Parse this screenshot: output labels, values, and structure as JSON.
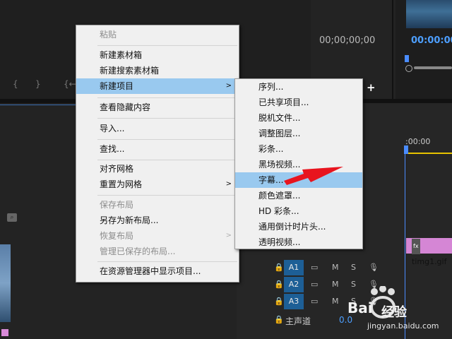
{
  "timecode_left": "00;00;00;00",
  "timecode_right": "00:00:00",
  "time_ruler_label": ":00:00",
  "context_menu": {
    "items": [
      {
        "label": "粘贴",
        "disabled": true
      },
      {
        "label": "新建素材箱"
      },
      {
        "label": "新建搜索素材箱"
      },
      {
        "label": "新建项目",
        "submenu": true,
        "highlighted": true
      },
      {
        "label": "查看隐藏内容"
      },
      {
        "label": "导入..."
      },
      {
        "label": "查找..."
      },
      {
        "label": "对齐网格"
      },
      {
        "label": "重置为网格",
        "submenu": true
      },
      {
        "label": "保存布局",
        "disabled": true
      },
      {
        "label": "另存为新布局..."
      },
      {
        "label": "恢复布局",
        "disabled": true,
        "submenu": true
      },
      {
        "label": "管理已保存的布局...",
        "disabled": true
      },
      {
        "label": "在资源管理器中显示项目..."
      }
    ]
  },
  "submenu": {
    "items": [
      {
        "label": "序列..."
      },
      {
        "label": "已共享项目..."
      },
      {
        "label": "脱机文件..."
      },
      {
        "label": "调整图层..."
      },
      {
        "label": "彩条..."
      },
      {
        "label": "黑场视频..."
      },
      {
        "label": "字幕...",
        "highlighted": true
      },
      {
        "label": "颜色遮罩..."
      },
      {
        "label": "HD 彩条..."
      },
      {
        "label": "通用倒计时片头..."
      },
      {
        "label": "透明视频..."
      }
    ]
  },
  "clip": {
    "fx": "fx",
    "name": "timg1.gif",
    "color": "#d586d5"
  },
  "tracks": [
    {
      "name": "A1",
      "m": "M",
      "s": "S"
    },
    {
      "name": "A2",
      "m": "M",
      "s": "S"
    },
    {
      "name": "A3",
      "m": "M",
      "s": "S"
    }
  ],
  "master_track": {
    "label": "主声道",
    "value": "0.0"
  },
  "watermark": {
    "brand": "Bai",
    "brand2": "经验",
    "url": "jingyan.baidu.com"
  },
  "colors": {
    "accent_blue": "#4a8cff",
    "highlight": "#99c9ef",
    "track_blue": "#1d5f96",
    "playhead_yellow": "#e6c200"
  }
}
